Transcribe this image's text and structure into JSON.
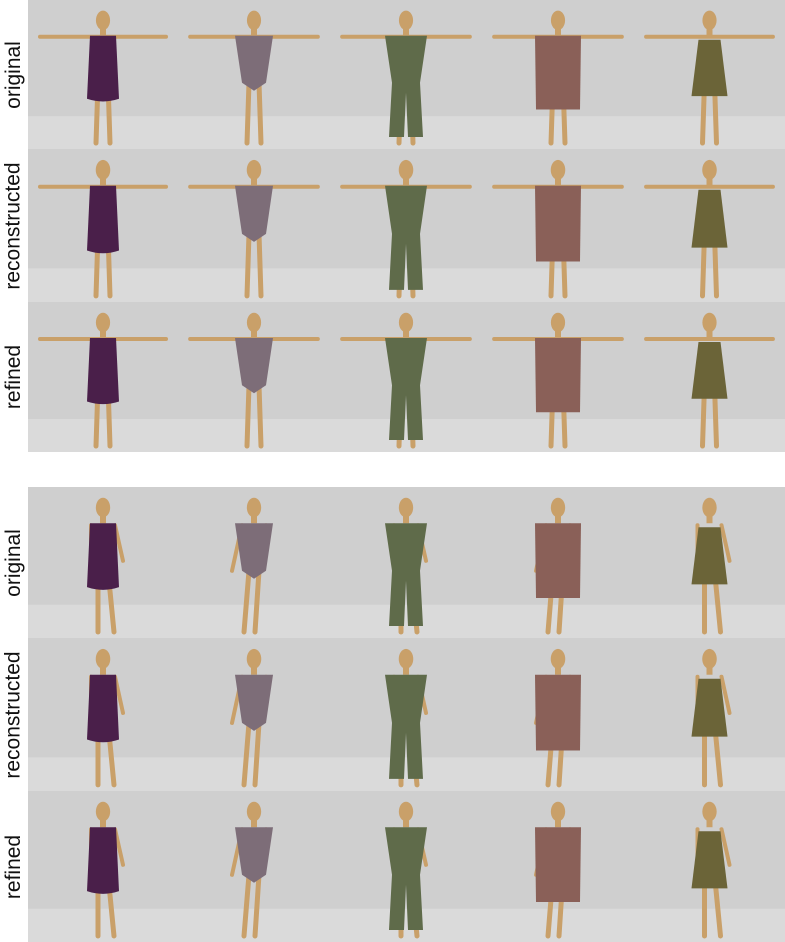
{
  "panels": [
    {
      "id": "tpose",
      "rows": [
        {
          "label": "original"
        },
        {
          "label": "reconstructed"
        },
        {
          "label": "refined"
        }
      ]
    },
    {
      "id": "posed",
      "rows": [
        {
          "label": "original"
        },
        {
          "label": "reconstructed"
        },
        {
          "label": "refined"
        }
      ]
    }
  ],
  "garments": [
    {
      "name": "sleeveless-dress",
      "color": "#4a1f4a"
    },
    {
      "name": "bodysuit",
      "color": "#7d6d78"
    },
    {
      "name": "jumpsuit",
      "color": "#5f6b4a"
    },
    {
      "name": "long-sleeve-dress",
      "color": "#8a6058"
    },
    {
      "name": "strap-dress",
      "color": "#6b6438"
    }
  ],
  "skin_color": "#c9a069",
  "background_color": "#cfcfcf",
  "floor_color": "#dadada"
}
